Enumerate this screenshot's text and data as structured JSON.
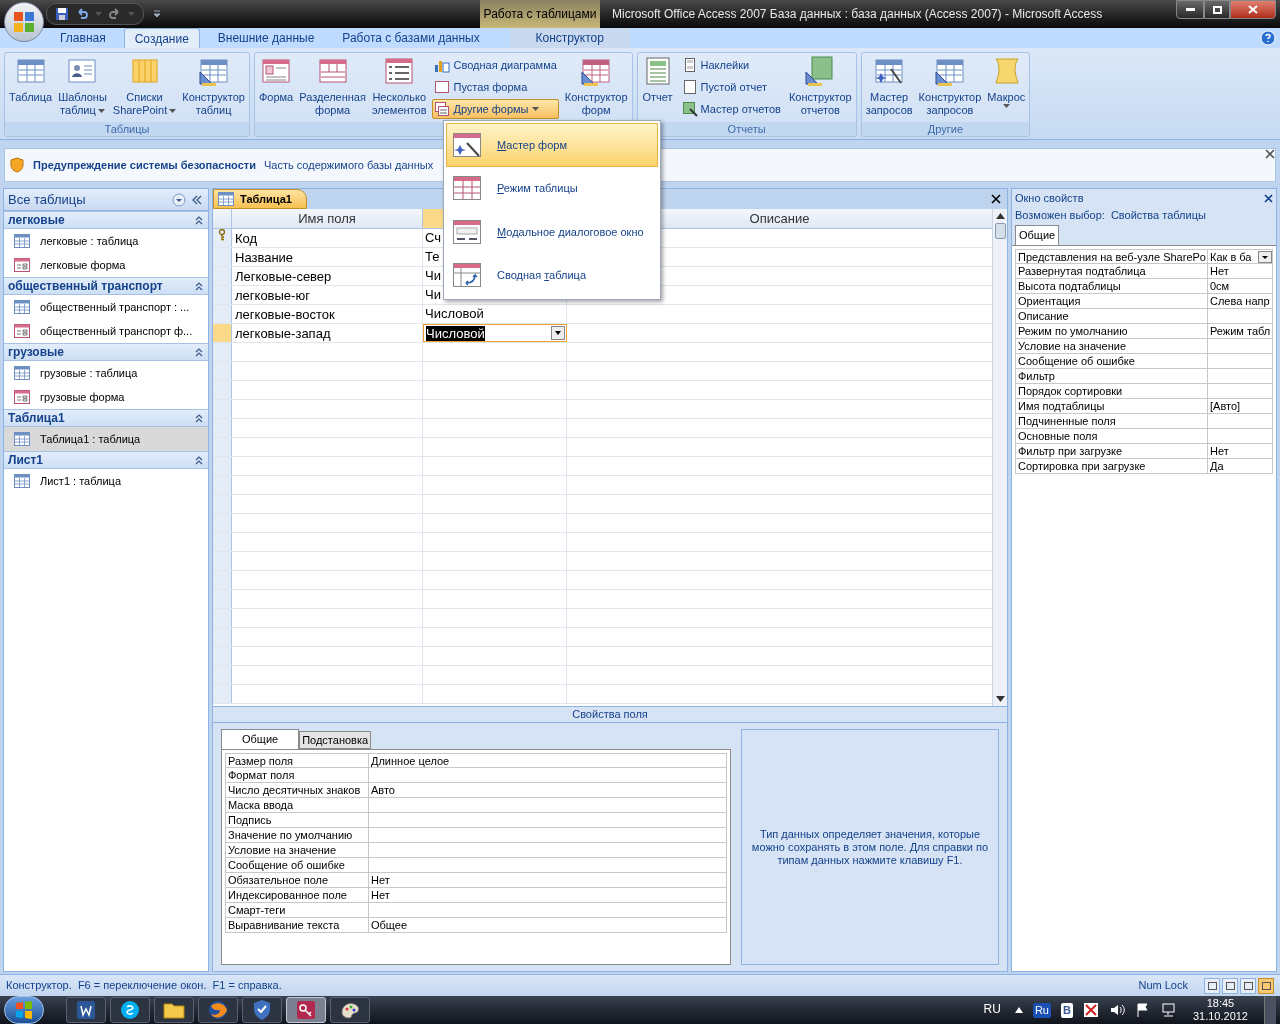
{
  "title_bar": {
    "contextual_tab": "Работа с таблицами",
    "title": "Microsoft Office Access 2007 База данных : база данных (Access 2007)  -  Microsoft Access"
  },
  "ribbon_tabs": [
    {
      "label": "Главная",
      "selected": false
    },
    {
      "label": "Создание",
      "selected": true
    },
    {
      "label": "Внешние данные",
      "selected": false
    },
    {
      "label": "Работа с базами данных",
      "selected": false
    }
  ],
  "contextual_tabs": [
    {
      "label": "Конструктор",
      "selected": false
    }
  ],
  "ribbon_groups": [
    {
      "label": "Таблицы",
      "buttons": [
        {
          "kind": "large",
          "lines": [
            "Таблица"
          ]
        },
        {
          "kind": "large",
          "lines": [
            "Шаблоны",
            "таблиц"
          ],
          "dropdown": true
        },
        {
          "kind": "large",
          "lines": [
            "Списки",
            "SharePoint"
          ],
          "dropdown": true
        },
        {
          "kind": "large",
          "lines": [
            "Конструктор",
            "таблиц"
          ]
        }
      ]
    },
    {
      "buttons": [
        {
          "kind": "large",
          "lines": [
            "Форма"
          ]
        },
        {
          "kind": "large",
          "lines": [
            "Разделенная",
            "форма"
          ]
        },
        {
          "kind": "large",
          "lines": [
            "Несколько",
            "элементов"
          ]
        },
        {
          "kind": "stack",
          "items": [
            {
              "label": "Сводная диаграмма",
              "pressed": false
            },
            {
              "label": "Пустая форма",
              "pressed": false
            },
            {
              "label": "Другие формы",
              "dropdown": true,
              "pressed": true
            }
          ]
        },
        {
          "kind": "large",
          "lines": [
            "Конструктор",
            "форм"
          ]
        }
      ]
    },
    {
      "label": "Отчеты",
      "buttons": [
        {
          "kind": "large",
          "lines": [
            "Отчет"
          ]
        },
        {
          "kind": "stack",
          "items": [
            {
              "label": "Наклейки",
              "pressed": false
            },
            {
              "label": "Пустой отчет",
              "pressed": false
            },
            {
              "label": "Мастер отчетов",
              "pressed": false
            }
          ]
        },
        {
          "kind": "large",
          "lines": [
            "Конструктор",
            "отчетов"
          ]
        }
      ]
    },
    {
      "label": "Другие",
      "buttons": [
        {
          "kind": "large",
          "lines": [
            "Мастер",
            "запросов"
          ]
        },
        {
          "kind": "large",
          "lines": [
            "Конструктор",
            "запросов"
          ]
        },
        {
          "kind": "large",
          "lines": [
            "Макрос"
          ],
          "dropdown": true
        }
      ]
    }
  ],
  "forms_menu": [
    {
      "key": "М",
      "post": "астер форм",
      "selected": true
    },
    {
      "key": "Р",
      "post": "ежим таблицы",
      "selected": false
    },
    {
      "key": "М",
      "post": "одальное диалоговое окно",
      "selected": false
    },
    {
      "pre": "Сводная ",
      "key": "т",
      "post": "аблица",
      "selected": false
    }
  ],
  "security_bar": {
    "title": "Предупреждение системы безопасности",
    "message": "Часть содержимого базы данных"
  },
  "nav_pane": {
    "title": "Все таблицы",
    "groups": [
      {
        "label": "легковые",
        "expanded": true,
        "items": [
          {
            "kind": "table",
            "label": "легковые : таблица",
            "selected": false
          },
          {
            "kind": "form",
            "label": "легковые форма",
            "selected": false
          }
        ]
      },
      {
        "label": "общественный транспорт",
        "expanded": true,
        "items": [
          {
            "kind": "table",
            "label": "общественный транспорт : ...",
            "selected": false
          },
          {
            "kind": "form",
            "label": "общественный транспорт ф...",
            "selected": false
          }
        ]
      },
      {
        "label": "грузовые",
        "expanded": true,
        "items": [
          {
            "kind": "table",
            "label": "грузовые : таблица",
            "selected": false
          },
          {
            "kind": "form",
            "label": "грузовые форма",
            "selected": false
          }
        ]
      },
      {
        "label": "Таблица1",
        "expanded": true,
        "items": [
          {
            "kind": "table",
            "label": "Таблица1 : таблица",
            "selected": true
          }
        ]
      },
      {
        "label": "Лист1",
        "expanded": true,
        "items": [
          {
            "kind": "table",
            "label": "Лист1 : таблица",
            "selected": false
          }
        ]
      }
    ]
  },
  "document": {
    "tab": "Таблица1",
    "columns": [
      "Имя поля",
      "Описание"
    ],
    "rows": [
      {
        "field": "Код",
        "type": "Сч",
        "primary_key": true,
        "selected": false
      },
      {
        "field": "Название",
        "type": "Те",
        "primary_key": false,
        "selected": false
      },
      {
        "field": "Легковые-север",
        "type": "Чи",
        "primary_key": false,
        "selected": false
      },
      {
        "field": "легковые-юг",
        "type": "Чи",
        "primary_key": false,
        "selected": false
      },
      {
        "field": "легковые-восток",
        "type": "Числовой",
        "primary_key": false,
        "selected": false
      },
      {
        "field": "легковые-запад",
        "type": "Числовой",
        "primary_key": false,
        "selected": true
      }
    ]
  },
  "field_properties": {
    "title": "Свойства поля",
    "tabs": [
      {
        "label": "Общие",
        "selected": true
      },
      {
        "label": "Подстановка",
        "selected": false
      }
    ],
    "rows": [
      {
        "name": "Размер поля",
        "value": "Длинное целое"
      },
      {
        "name": "Формат поля"
      },
      {
        "name": "Число десятичных знаков",
        "value": "Авто"
      },
      {
        "name": "Маска ввода"
      },
      {
        "name": "Подпись"
      },
      {
        "name": "Значение по умолчанию"
      },
      {
        "name": "Условие на значение"
      },
      {
        "name": "Сообщение об ошибке"
      },
      {
        "name": "Обязательное поле",
        "value": "Нет"
      },
      {
        "name": "Индексированное поле",
        "value": "Нет"
      },
      {
        "name": "Смарт-теги"
      },
      {
        "name": "Выравнивание текста",
        "value": "Общее"
      }
    ],
    "help": "Тип данных определяет значения, которые можно сохранять в этом поле.  Для справки по типам данных нажмите клавишу F1."
  },
  "property_sheet": {
    "title": "Окно свойств",
    "selection_label": "Возможен выбор:",
    "selection": "Свойства таблицы",
    "tab": "Общие",
    "rows": [
      {
        "name": "Представления на веб-узле SharePo",
        "value": "Как в ба",
        "dropdown": true
      },
      {
        "name": "Развернутая подтаблица",
        "value": "Нет"
      },
      {
        "name": "Высота подтаблицы",
        "value": "0см"
      },
      {
        "name": "Ориентация",
        "value": "Слева напр"
      },
      {
        "name": "Описание"
      },
      {
        "name": "Режим по умолчанию",
        "value": "Режим табл"
      },
      {
        "name": "Условие на значение"
      },
      {
        "name": "Сообщение об ошибке"
      },
      {
        "name": "Фильтр"
      },
      {
        "name": "Порядок сортировки"
      },
      {
        "name": "Имя подтаблицы",
        "value": "[Авто]"
      },
      {
        "name": "Подчиненные поля"
      },
      {
        "name": "Основные поля"
      },
      {
        "name": "Фильтр при загрузке",
        "value": "Нет"
      },
      {
        "name": "Сортировка при загрузке",
        "value": "Да"
      }
    ]
  },
  "status_bar": {
    "text": "Конструктор.  F6 = переключение окон.  F1 = справка.",
    "indicator": "Num Lock",
    "views": [
      {
        "selected": false
      },
      {
        "selected": false
      },
      {
        "selected": false
      },
      {
        "selected": true
      }
    ]
  },
  "taskbar": {
    "apps": [
      {
        "selected": false
      },
      {
        "selected": false
      },
      {
        "selected": false
      },
      {
        "selected": false
      },
      {
        "selected": false
      },
      {
        "selected": true
      },
      {
        "selected": false
      }
    ],
    "language": "RU",
    "tray_badges": [
      "Ru",
      "B"
    ],
    "time": "18:45",
    "date": "31.10.2012"
  }
}
